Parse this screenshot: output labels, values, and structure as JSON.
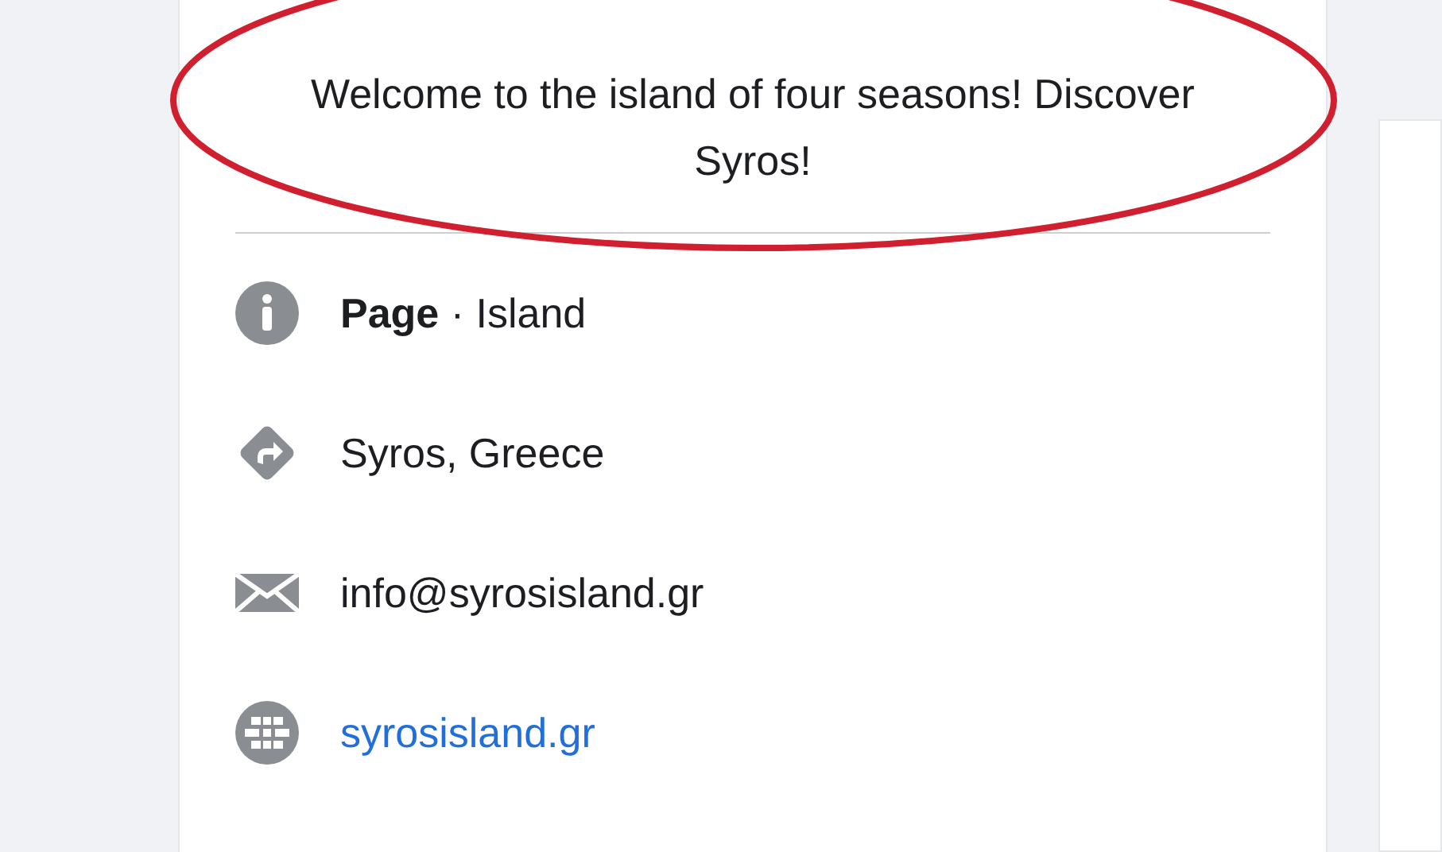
{
  "about": {
    "description": "Welcome to the island of four seasons! Discover Syros!",
    "items": [
      {
        "kind": "info",
        "text": "**Page** · Island"
      },
      {
        "kind": "location",
        "text": "Syros, Greece"
      },
      {
        "kind": "email",
        "text": "info@syrosisland.gr"
      },
      {
        "kind": "website",
        "text": "syrosisland.gr"
      }
    ]
  }
}
